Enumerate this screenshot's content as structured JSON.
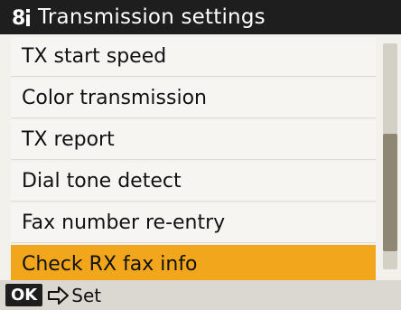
{
  "header": {
    "icon": "settings-menu-icon",
    "icon_glyph": "8",
    "title": "Transmission settings"
  },
  "menu": {
    "items": [
      {
        "label": "TX start speed",
        "selected": false
      },
      {
        "label": "Color transmission",
        "selected": false
      },
      {
        "label": "TX report",
        "selected": false
      },
      {
        "label": "Dial tone detect",
        "selected": false
      },
      {
        "label": "Fax number re-entry",
        "selected": false
      },
      {
        "label": "Check RX fax info",
        "selected": true
      }
    ]
  },
  "footer": {
    "ok_label": "OK",
    "action_label": "Set",
    "arrow_icon": "arrow-right-icon"
  },
  "colors": {
    "titlebar": "#1e1e1e",
    "selected": "#f2a61b",
    "background": "#f2f1ec"
  }
}
